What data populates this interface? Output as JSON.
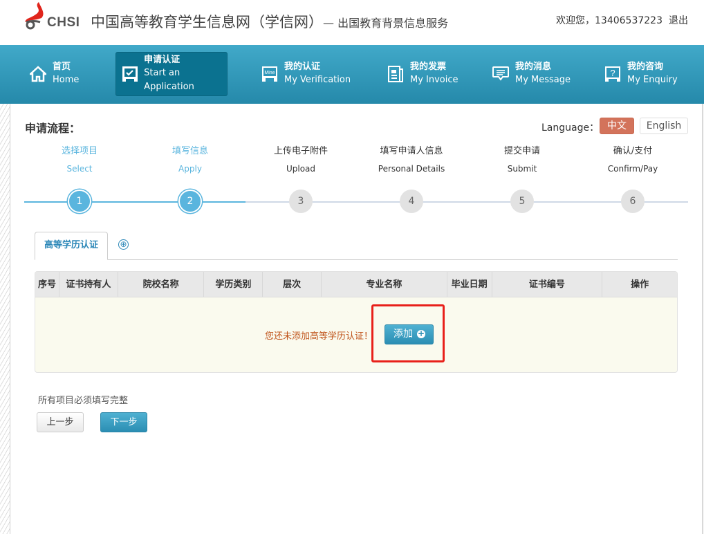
{
  "header": {
    "logo_text": "CHSI",
    "site_title": "中国高等教育学生信息网（学信网）",
    "site_subtitle": "— 出国教育背景信息服务",
    "welcome": "欢迎您，13406537223",
    "logout": "退出",
    "colors": {
      "logo_red": "#e0251c",
      "logo_gray": "#555555"
    }
  },
  "nav": {
    "items": [
      {
        "cn": "首页",
        "en": "Home",
        "icon": "home-icon",
        "active": false
      },
      {
        "cn": "申请认证",
        "en": "Start an Application",
        "icon": "checkbox-icon",
        "active": true
      },
      {
        "cn": "我的认证",
        "en": "My Verification",
        "icon": "mine-icon",
        "active": false
      },
      {
        "cn": "我的发票",
        "en": "My Invoice",
        "icon": "invoice-icon",
        "active": false
      },
      {
        "cn": "我的消息",
        "en": "My Message",
        "icon": "message-icon",
        "active": false
      },
      {
        "cn": "我的咨询",
        "en": "My Enquiry",
        "icon": "question-icon",
        "active": false
      }
    ]
  },
  "process": {
    "title": "申请流程：",
    "language_label": "Language：",
    "language_options": [
      "中文",
      "English"
    ],
    "language_selected": "中文",
    "steps": [
      {
        "num": "1",
        "cn": "选择项目",
        "en": "Select",
        "done": true
      },
      {
        "num": "2",
        "cn": "填写信息",
        "en": "Apply",
        "done": true
      },
      {
        "num": "3",
        "cn": "上传电子附件",
        "en": "Upload",
        "done": false
      },
      {
        "num": "4",
        "cn": "填写申请人信息",
        "en": "Personal Details",
        "done": false
      },
      {
        "num": "5",
        "cn": "提交申请",
        "en": "Submit",
        "done": false
      },
      {
        "num": "6",
        "cn": "确认/支付",
        "en": "Confirm/Pay",
        "done": false
      }
    ]
  },
  "tabs": {
    "active_label": "高等学历认证",
    "add_icon": "⊕"
  },
  "table": {
    "columns": [
      "序号",
      "证书持有人",
      "院校名称",
      "学历类别",
      "层次",
      "专业名称",
      "毕业日期",
      "证书编号",
      "操作"
    ],
    "empty_message": "您还未添加高等学历认证！",
    "add_button": "添加",
    "add_icon": "+"
  },
  "footer": {
    "required_note": "所有项目必须填写完整",
    "prev_button": "上一步",
    "next_button": "下一步"
  }
}
